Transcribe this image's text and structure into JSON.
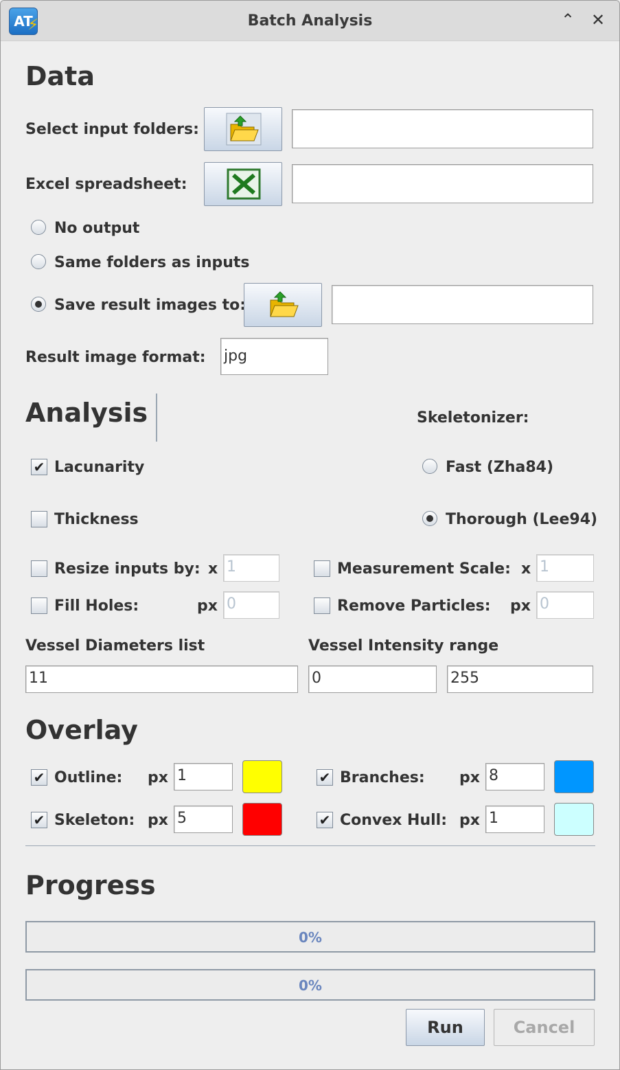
{
  "window": {
    "title": "Batch Analysis",
    "app_icon_text": "AT"
  },
  "data_section": {
    "heading": "Data",
    "input_folders_label": "Select input folders:",
    "input_folders_value": "",
    "excel_label": "Excel spreadsheet:",
    "excel_value": "",
    "output_options": [
      {
        "label": "No output",
        "selected": false
      },
      {
        "label": "Same folders as inputs",
        "selected": false
      },
      {
        "label": "Save result images to:",
        "selected": true
      }
    ],
    "save_path_value": "",
    "format_label": "Result image format:",
    "format_value": "jpg"
  },
  "analysis_section": {
    "heading": "Analysis",
    "skeletonizer_label": "Skeletonizer:",
    "lacunarity": {
      "label": "Lacunarity",
      "checked": true
    },
    "thickness": {
      "label": "Thickness",
      "checked": false
    },
    "skeletonizer_options": [
      {
        "label": "Fast (Zha84)",
        "selected": false
      },
      {
        "label": "Thorough (Lee94)",
        "selected": true
      }
    ],
    "resize": {
      "label": "Resize inputs by:",
      "unit": "x",
      "value": "1",
      "checked": false
    },
    "measurement_scale": {
      "label": "Measurement Scale:",
      "unit": "x",
      "value": "1",
      "checked": false
    },
    "fill_holes": {
      "label": "Fill Holes:",
      "unit": "px",
      "value": "0",
      "checked": false
    },
    "remove_particles": {
      "label": "Remove Particles:",
      "unit": "px",
      "value": "0",
      "checked": false
    },
    "diameters_label": "Vessel Diameters list",
    "diameters_value": "11",
    "intensity_label": "Vessel Intensity range",
    "intensity_min": "0",
    "intensity_max": "255"
  },
  "overlay_section": {
    "heading": "Overlay",
    "outline": {
      "label": "Outline:",
      "unit": "px",
      "value": "1",
      "checked": true,
      "color": "#ffff00"
    },
    "skeleton": {
      "label": "Skeleton:",
      "unit": "px",
      "value": "5",
      "checked": true,
      "color": "#ff0000"
    },
    "branches": {
      "label": "Branches:",
      "unit": "px",
      "value": "8",
      "checked": true,
      "color": "#0096ff"
    },
    "convex_hull": {
      "label": "Convex Hull:",
      "unit": "px",
      "value": "1",
      "checked": true,
      "color": "#ccffff"
    }
  },
  "progress_section": {
    "heading": "Progress",
    "bar1_text": "0%",
    "bar1_value": 0,
    "bar2_text": "0%",
    "bar2_value": 0
  },
  "buttons": {
    "run": "Run",
    "cancel": "Cancel"
  },
  "icons": {
    "folder": "folder-open-icon",
    "excel": "excel-icon",
    "minimize": "chevron-up-icon",
    "close": "close-icon"
  }
}
